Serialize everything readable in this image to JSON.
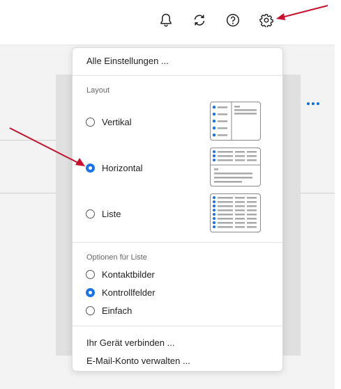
{
  "toolbar": {
    "icons": [
      "bell-icon",
      "sync-icon",
      "help-icon",
      "settings-gear-icon"
    ]
  },
  "menu": {
    "all_settings": "Alle Einstellungen ...",
    "layout": {
      "heading": "Layout",
      "options": [
        {
          "label": "Vertikal",
          "selected": false,
          "thumbnail": "vertical-layout-thumbnail"
        },
        {
          "label": "Horizontal",
          "selected": true,
          "thumbnail": "horizontal-layout-thumbnail"
        },
        {
          "label": "Liste",
          "selected": false,
          "thumbnail": "list-layout-thumbnail"
        }
      ]
    },
    "list_options": {
      "heading": "Optionen für Liste",
      "options": [
        {
          "label": "Kontaktbilder",
          "selected": false
        },
        {
          "label": "Kontrollfelder",
          "selected": true
        },
        {
          "label": "Einfach",
          "selected": false
        }
      ]
    },
    "connect_device": "Ihr Gerät verbinden ...",
    "manage_account": "E-Mail-Konto verwalten ..."
  },
  "colors": {
    "accent": "#1a73e8",
    "annotation_arrow": "#c8102e",
    "thumb_dot": "#1a73e8",
    "thumb_bar": "#a8a8a8"
  }
}
